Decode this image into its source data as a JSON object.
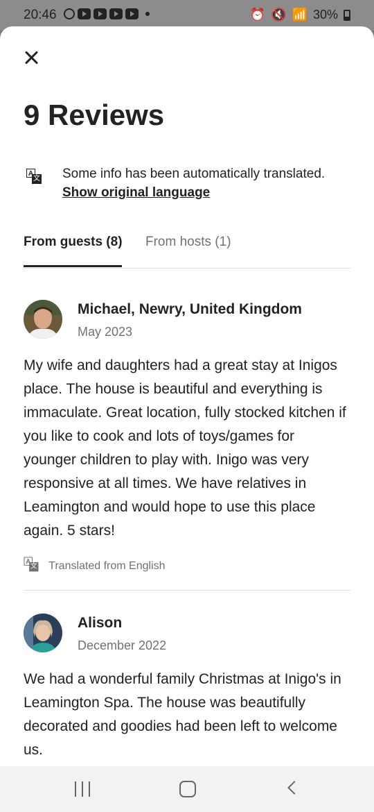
{
  "status_bar": {
    "time": "20:46",
    "battery": "30%"
  },
  "header": {
    "title": "9 Reviews"
  },
  "translation_banner": {
    "text": "Some info has been automatically translated.",
    "link": "Show original language"
  },
  "tabs": [
    {
      "label": "From guests (8)",
      "active": true
    },
    {
      "label": "From hosts (1)",
      "active": false
    }
  ],
  "reviews": [
    {
      "name": "Michael, Newry, United Kingdom",
      "date": "May 2023",
      "body": "My wife and daughters had a great stay at Inigos place. The house is beautiful and everything is immaculate. Great location, fully stocked kitchen if you like to cook and lots of toys/games for younger children to play with. Inigo was very responsive at all times. We have relatives in Leamington and would hope to use this place again. 5 stars!",
      "translated_note": "Translated from English"
    },
    {
      "name": "Alison",
      "date": "December 2022",
      "body": "We had a wonderful family Christmas at Inigo's in Leamington Spa. The house was beautifully decorated and goodies had been left to welcome us."
    }
  ],
  "icons": {
    "close": "close-icon",
    "translate": "translate-icon",
    "nav_recents": "recents-icon",
    "nav_home": "home-icon",
    "nav_back": "back-icon"
  }
}
